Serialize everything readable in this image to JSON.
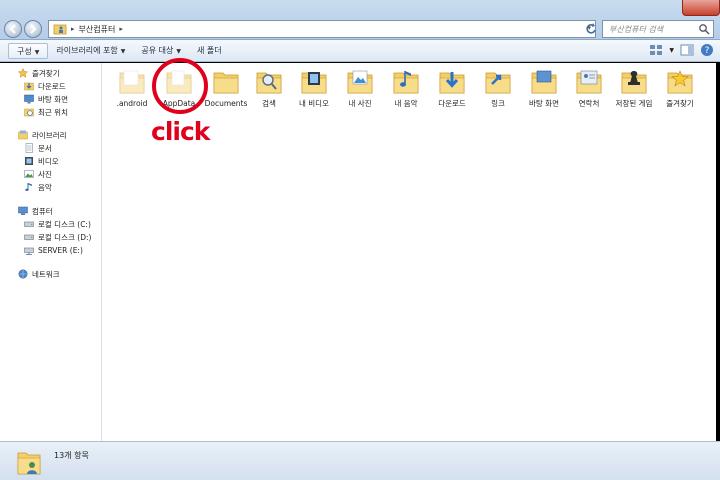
{
  "address": {
    "path": "부산컴퓨터"
  },
  "search": {
    "placeholder": "부산컴퓨터 검색"
  },
  "toolbar": {
    "organize": "구성",
    "include_library": "라이브러리에 포함",
    "share_with": "공유 대상",
    "new_folder": "새 폴더"
  },
  "nav": {
    "favorites": "즐겨찾기",
    "downloads": "다운로드",
    "desktop": "바탕 화면",
    "recent": "최근 위치",
    "libraries": "라이브러리",
    "documents": "문서",
    "videos": "비디오",
    "pictures": "사진",
    "music": "음악",
    "computer": "컴퓨터",
    "drive_c": "로컬 디스크 (C:)",
    "drive_d": "로컬 디스크 (D:)",
    "drive_e": "SERVER (E:)",
    "network": "네트워크"
  },
  "items": [
    {
      "name": ".android",
      "icon": "folder-icon"
    },
    {
      "name": "AppData",
      "icon": "folder-icon"
    },
    {
      "name": "Documents",
      "icon": "folder-icon"
    },
    {
      "name": "검색",
      "icon": "search-folder-icon"
    },
    {
      "name": "내 비디오",
      "icon": "videos-folder-icon"
    },
    {
      "name": "내 사진",
      "icon": "pictures-folder-icon"
    },
    {
      "name": "내 음악",
      "icon": "music-folder-icon"
    },
    {
      "name": "다운로드",
      "icon": "downloads-folder-icon"
    },
    {
      "name": "링크",
      "icon": "links-folder-icon"
    },
    {
      "name": "바탕 화면",
      "icon": "desktop-folder-icon"
    },
    {
      "name": "연락처",
      "icon": "contacts-folder-icon"
    },
    {
      "name": "저장된 게임",
      "icon": "saved-games-folder-icon"
    },
    {
      "name": "즐겨찾기",
      "icon": "favorites-folder-icon"
    }
  ],
  "annotation": {
    "text": "click",
    "color": "#e0001b"
  },
  "status": {
    "count": "13개 항목"
  },
  "colors": {
    "folder": "#f2cf6b",
    "folder_dark": "#d9a833",
    "accent_red": "#e0001b",
    "chrome": "#c9dcef"
  }
}
